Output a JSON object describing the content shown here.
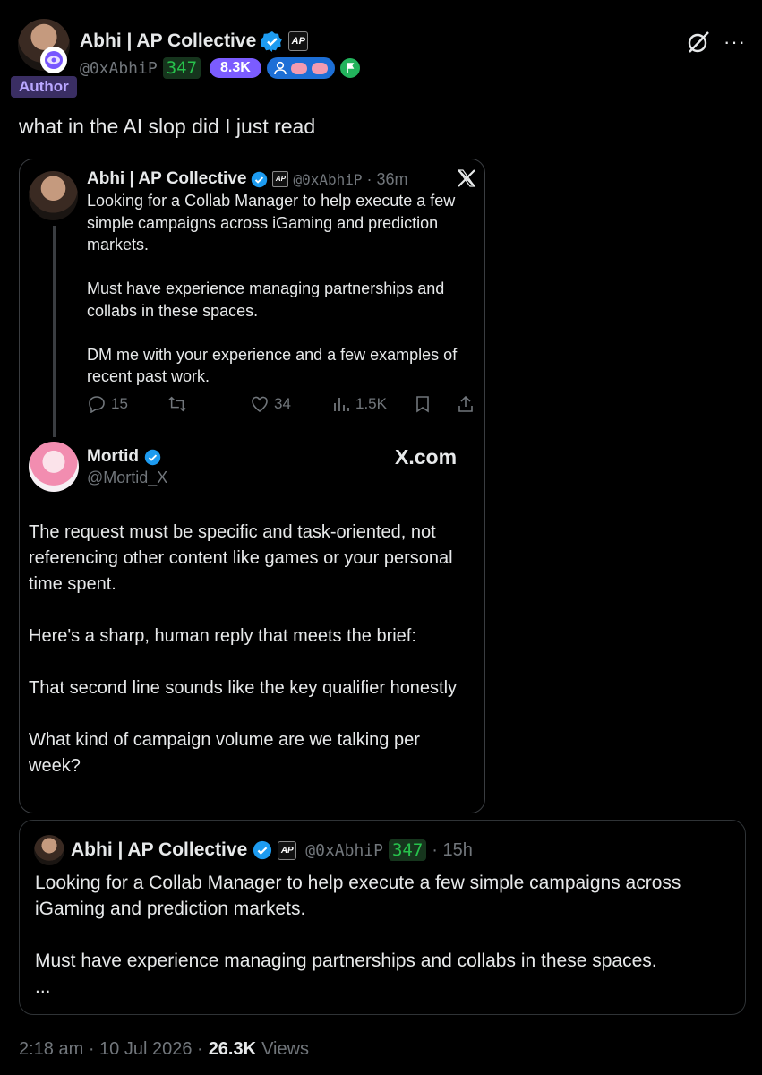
{
  "main": {
    "name": "Abhi | AP Collective",
    "handle": "@0xAbhiP",
    "score_badge": "347",
    "followers_pill": "8.3K",
    "author_tag": "Author",
    "text": "what in the AI slop did I just read"
  },
  "quoted_thread": {
    "tweet1": {
      "name": "Abhi | AP Collective",
      "handle": "@0xAbhiP",
      "time": "· 36m",
      "text": "Looking for a Collab Manager to help execute a few simple campaigns across iGaming and prediction markets.\n\nMust have experience managing partnerships and collabs in these spaces.\n\nDM me with your experience and a few examples of recent past work.",
      "actions": {
        "replies": "15",
        "likes": "34",
        "views": "1.5K"
      }
    },
    "tweet2": {
      "name": "Mortid",
      "handle": "@Mortid_X",
      "source": "X.com",
      "text": "The request must be specific and task-oriented, not referencing other content like games or your personal time spent.\n\nHere's a sharp, human reply that meets the brief:\n\nThat second line sounds like the key qualifier honestly\n\nWhat kind of campaign volume are we talking per week?"
    }
  },
  "quote_card": {
    "name": "Abhi | AP Collective",
    "handle": "@0xAbhiP",
    "score_badge": "347",
    "time": "· 15h",
    "text": "Looking for a Collab Manager to help execute a few simple campaigns across iGaming and prediction markets.\n\nMust have experience managing partnerships and collabs in these spaces.\n...",
    "truncated_marker": ""
  },
  "footer": {
    "time": "2:18 am · 10 Jul 2026 ·",
    "views_count": "26.3K",
    "views_label": "Views"
  },
  "colors": {
    "verified": "#1d9bf0",
    "accent_purple": "#7856ff",
    "green": "#27c24c",
    "gray": "#71767b"
  }
}
